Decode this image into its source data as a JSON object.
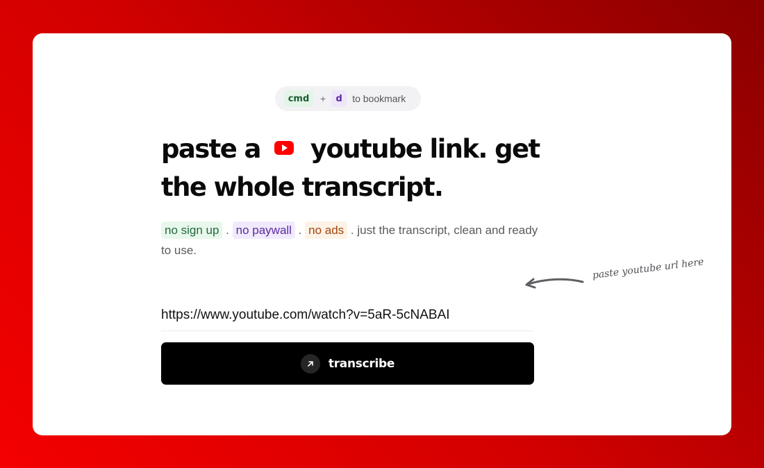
{
  "shortcut": {
    "key1": "cmd",
    "plus": "+",
    "key2": "d",
    "label": "to bookmark"
  },
  "headline": {
    "part1": "paste a",
    "part2": "youtube link. get the whole transcript."
  },
  "subtitle": {
    "tag1": "no sign up",
    "sep1": " . ",
    "tag2": "no paywall",
    "sep2": " . ",
    "tag3": "no ads",
    "rest": " . just the transcript, clean and ready to use."
  },
  "hint": {
    "text": "paste youtube url here"
  },
  "url_input": {
    "value": "https://www.youtube.com/watch?v=5aR-5cNABAI"
  },
  "transcribe_button": {
    "label": "transcribe"
  },
  "icons": [
    "youtube-logo-icon",
    "curved-arrow-icon",
    "arrow-up-right-icon"
  ],
  "colors": {
    "background": "#e00000",
    "card": "#ffffff",
    "button": "#000000",
    "youtube_red": "#ff0000"
  }
}
